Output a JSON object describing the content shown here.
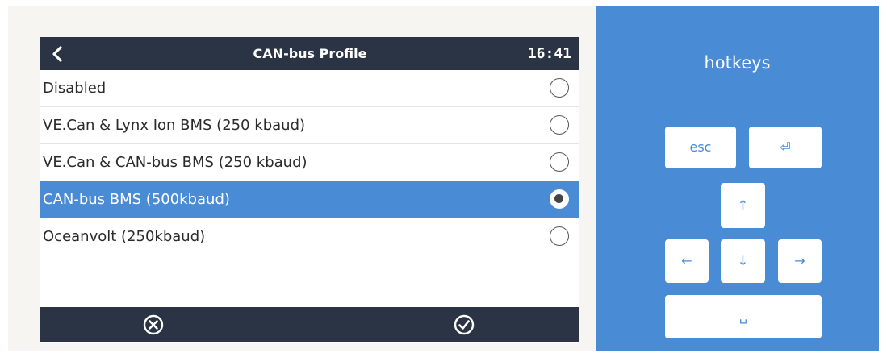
{
  "header": {
    "title": "CAN-bus Profile",
    "time": "16:41"
  },
  "options": [
    {
      "label": "Disabled",
      "selected": false
    },
    {
      "label": "VE.Can & Lynx Ion BMS (250 kbaud)",
      "selected": false
    },
    {
      "label": "VE.Can & CAN-bus BMS (250 kbaud)",
      "selected": false
    },
    {
      "label": "CAN-bus BMS (500kbaud)",
      "selected": true
    },
    {
      "label": "Oceanvolt (250kbaud)",
      "selected": false
    }
  ],
  "hotkeys": {
    "title": "hotkeys",
    "esc": "esc",
    "enter": "⏎",
    "up": "↑",
    "left": "←",
    "down": "↓",
    "right": "→",
    "space": "␣"
  },
  "colors": {
    "header_bg": "#2a3444",
    "accent": "#4a8bd6"
  },
  "icons": {
    "back": "chevron-left-icon",
    "cancel": "cancel-circle-icon",
    "confirm": "check-circle-icon"
  }
}
